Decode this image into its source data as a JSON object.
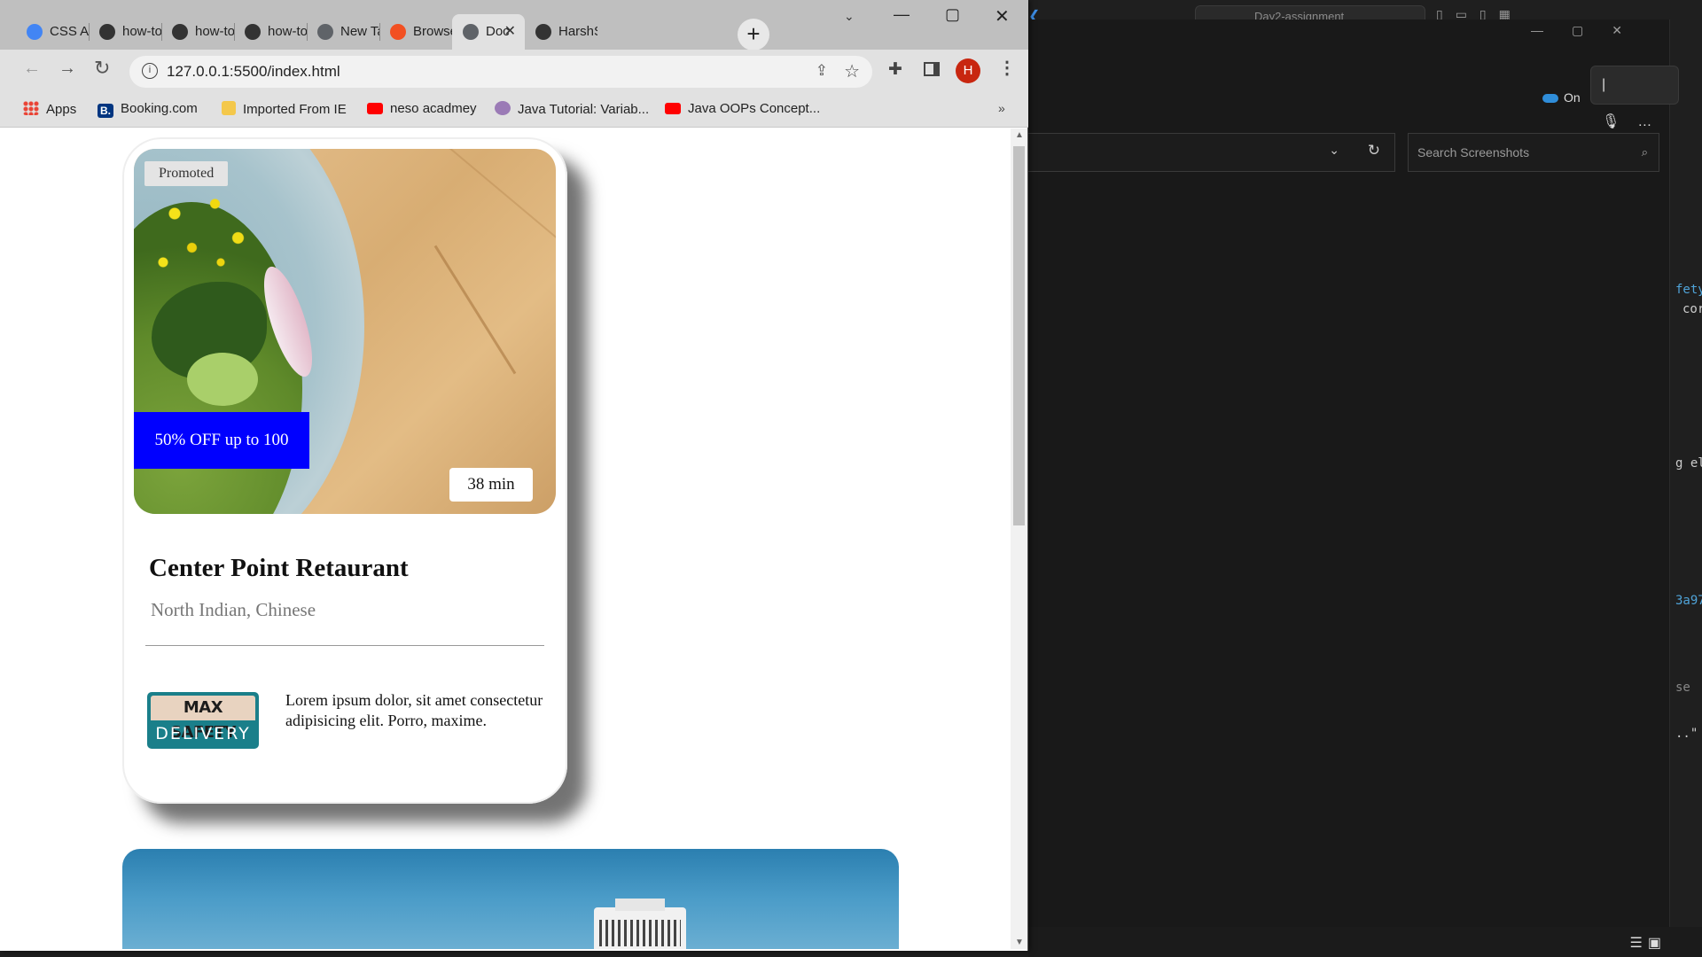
{
  "browser": {
    "tabs": [
      {
        "label": "CSS Ass",
        "icon": "google-docs-icon",
        "color": "#4285f4"
      },
      {
        "label": "how-to",
        "icon": "github-icon",
        "color": "#333333"
      },
      {
        "label": "how-to",
        "icon": "github-icon",
        "color": "#333333"
      },
      {
        "label": "how-to",
        "icon": "github-icon",
        "color": "#333333"
      },
      {
        "label": "New Ta",
        "icon": "chrome-icon",
        "color": "#5f6368"
      },
      {
        "label": "Browse",
        "icon": "microsoft-icon",
        "color": "#f25022"
      },
      {
        "label": "Doc",
        "icon": "globe-icon",
        "color": "#5f6368",
        "active": true
      },
      {
        "label": "HarshS",
        "icon": "github-icon",
        "color": "#333333"
      }
    ],
    "new_tab": "+",
    "url": "127.0.0.1:5500/index.html",
    "profile_initial": "H",
    "profile_color": "#c8260f",
    "bookmarks": [
      {
        "label": "Apps",
        "icon": "apps-grid-icon"
      },
      {
        "label": "Booking.com",
        "icon": "booking-icon"
      },
      {
        "label": "Imported From IE",
        "icon": "folder-icon"
      },
      {
        "label": "neso acadmey",
        "icon": "youtube-icon"
      },
      {
        "label": "Java Tutorial: Variab...",
        "icon": "avatar-icon"
      },
      {
        "label": "Java OOPs Concept...",
        "icon": "youtube-icon"
      }
    ],
    "bookmarks_more": "»"
  },
  "card": {
    "promoted": "Promoted",
    "discount": "50% OFF up to 100",
    "delivery_time": "38 min",
    "name": "Center Point Retaurant",
    "cuisine": "North Indian, Chinese",
    "safety_top": "MAX SAFETY",
    "safety_bottom": "DELIVERY",
    "description": "Lorem ipsum dolor, sit amet consectetur adipisicing elit. Porro, maxime.",
    "discount_color": "#0000ff"
  },
  "background_app": {
    "vscode_search": "Day2-assignment",
    "onedrive_label": "On",
    "search_placeholder": "Search Screenshots",
    "code_fragments": [
      "fety",
      "cor",
      "g el",
      "3a97",
      "se",
      "..\""
    ]
  }
}
